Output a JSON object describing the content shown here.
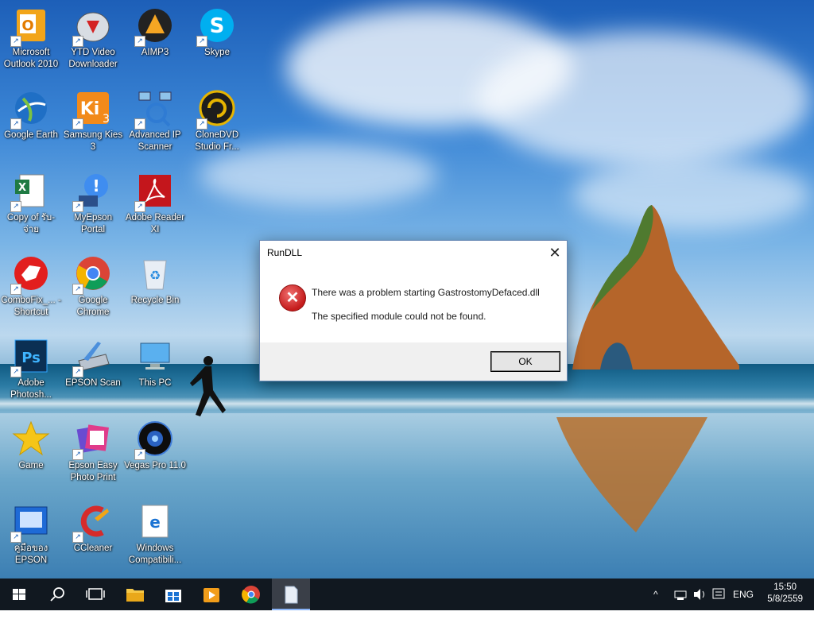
{
  "desktop": {
    "icons": [
      {
        "label": "Microsoft Outlook 2010",
        "icon": "outlook-icon"
      },
      {
        "label": "YTD Video Downloader",
        "icon": "ytd-icon"
      },
      {
        "label": "AIMP3",
        "icon": "aimp-icon"
      },
      {
        "label": "Skype",
        "icon": "skype-icon"
      },
      {
        "label": "Google Earth",
        "icon": "google-earth-icon"
      },
      {
        "label": "Samsung Kies 3",
        "icon": "kies-icon"
      },
      {
        "label": "Advanced IP Scanner",
        "icon": "ip-scanner-icon"
      },
      {
        "label": "CloneDVD Studio Fr...",
        "icon": "clonedvd-icon"
      },
      {
        "label": "Copy of รับ-จ่าย",
        "icon": "excel-icon"
      },
      {
        "label": "MyEpson Portal",
        "icon": "myepson-icon"
      },
      {
        "label": "Adobe Reader XI",
        "icon": "adobe-reader-icon"
      },
      {
        "label": "ComboFix_... - Shortcut",
        "icon": "combofix-icon"
      },
      {
        "label": "Google Chrome",
        "icon": "chrome-icon"
      },
      {
        "label": "Recycle Bin",
        "icon": "recycle-bin-icon"
      },
      {
        "label": "Adobe Photosh...",
        "icon": "photoshop-icon"
      },
      {
        "label": "EPSON Scan",
        "icon": "epson-scan-icon"
      },
      {
        "label": "This PC",
        "icon": "this-pc-icon"
      },
      {
        "label": "Game",
        "icon": "star-icon"
      },
      {
        "label": "Epson Easy Photo Print",
        "icon": "epson-photo-icon"
      },
      {
        "label": "Vegas Pro 11.0",
        "icon": "vegas-icon"
      },
      {
        "label": "คู่มือของ EPSON",
        "icon": "epson-manual-icon"
      },
      {
        "label": "CCleaner",
        "icon": "ccleaner-icon"
      },
      {
        "label": "Windows Compatibili...",
        "icon": "edge-doc-icon"
      }
    ]
  },
  "dialog": {
    "title": "RunDLL",
    "close": "✕",
    "message_line1": "There was a problem starting GastrostomyDefaced.dll",
    "message_line2": "The specified module could not be found.",
    "ok_label": "OK",
    "error_glyph": "✕"
  },
  "taskbar": {
    "language": "ENG",
    "time": "15:50",
    "date": "5/8/2559",
    "tray_chevron": "^"
  },
  "colors": {
    "taskbar_bg": "#111820",
    "error_red": "#c41b1b",
    "dialog_footer": "#f0f0f0"
  }
}
